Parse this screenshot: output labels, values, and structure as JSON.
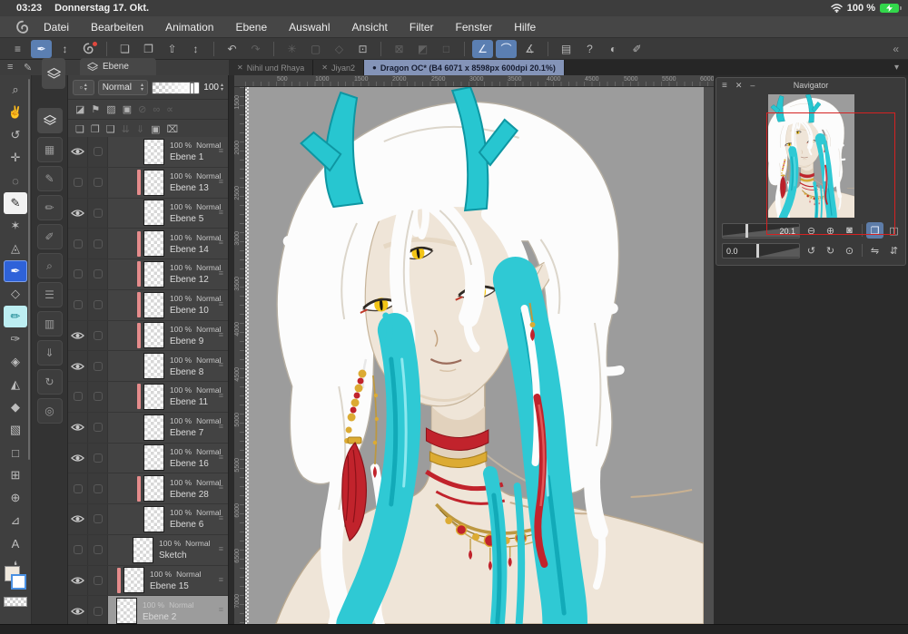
{
  "status_bar": {
    "time": "03:23",
    "date": "Donnerstag 17. Okt.",
    "battery_label": "100 %"
  },
  "menu_bar": {
    "items": [
      {
        "name": "menu-datei",
        "label": "Datei"
      },
      {
        "name": "menu-bearbeiten",
        "label": "Bearbeiten"
      },
      {
        "name": "menu-animation",
        "label": "Animation"
      },
      {
        "name": "menu-ebene",
        "label": "Ebene"
      },
      {
        "name": "menu-auswahl",
        "label": "Auswahl"
      },
      {
        "name": "menu-ansicht",
        "label": "Ansicht"
      },
      {
        "name": "menu-filter",
        "label": "Filter"
      },
      {
        "name": "menu-fenster",
        "label": "Fenster"
      },
      {
        "name": "menu-hilfe",
        "label": "Hilfe"
      }
    ]
  },
  "toolbar": {
    "buttons": [
      {
        "name": "main-menu-button",
        "glyph": "≡",
        "state": "normal"
      },
      {
        "name": "quick-access-button",
        "glyph": "✒",
        "state": "active"
      },
      {
        "name": "quick-access-expander",
        "glyph": "↕",
        "state": "normal"
      },
      {
        "name": "clip-studio-home-button",
        "kind": "logo",
        "state": "normal"
      },
      {
        "name": "divider",
        "kind": "divider",
        "interactable": false
      },
      {
        "name": "new-canvas-button",
        "glyph": "❏",
        "state": "normal"
      },
      {
        "name": "open-file-button",
        "glyph": "❐",
        "state": "normal"
      },
      {
        "name": "save-button",
        "glyph": "⇧",
        "state": "normal"
      },
      {
        "name": "save-expander",
        "glyph": "↕",
        "state": "normal"
      },
      {
        "name": "divider",
        "kind": "divider",
        "interactable": false
      },
      {
        "name": "undo-button",
        "glyph": "↶",
        "state": "normal"
      },
      {
        "name": "redo-button",
        "glyph": "↷",
        "state": "dim"
      },
      {
        "name": "divider",
        "kind": "divider",
        "interactable": false
      },
      {
        "name": "processing-indicator",
        "glyph": "✳",
        "state": "dim"
      },
      {
        "name": "select-area-button",
        "glyph": "▢",
        "state": "dim"
      },
      {
        "name": "deselect-button",
        "glyph": "◇",
        "state": "dim"
      },
      {
        "name": "transform-button",
        "glyph": "⊡",
        "state": "normal"
      },
      {
        "name": "divider",
        "kind": "divider",
        "interactable": false
      },
      {
        "name": "snap-off-button",
        "glyph": "⊠",
        "state": "dim"
      },
      {
        "name": "snap-gradient-button",
        "glyph": "◩",
        "state": "dim"
      },
      {
        "name": "snap-square-button",
        "glyph": "□",
        "state": "dim"
      },
      {
        "name": "divider",
        "kind": "divider",
        "interactable": false
      },
      {
        "name": "snap-to-ruler-button",
        "glyph": "∠",
        "state": "active"
      },
      {
        "name": "snap-to-special-ruler-button",
        "glyph": "⌒",
        "state": "active"
      },
      {
        "name": "snap-to-guide-button",
        "glyph": "∡",
        "state": "normal"
      },
      {
        "name": "divider",
        "kind": "divider",
        "interactable": false
      },
      {
        "name": "palette-layout-button",
        "glyph": "▤",
        "state": "normal"
      },
      {
        "name": "help-button",
        "glyph": "?",
        "state": "normal"
      },
      {
        "name": "display-settings-button",
        "glyph": "◐",
        "state": "normal"
      },
      {
        "name": "stylus-disconnect-button",
        "glyph": "✐",
        "state": "normal"
      }
    ],
    "collapse_glyph": "«"
  },
  "tab_bar": {
    "tabs": [
      {
        "name": "tab-nihil-und-rhayan",
        "prefix": "✕",
        "label": "Nihil und Rhaya",
        "state": "inactive"
      },
      {
        "name": "tab-jiyan2",
        "prefix": "✕",
        "label": "Jiyan2",
        "state": "inactive"
      },
      {
        "name": "tab-dragon-oc",
        "prefix": "●",
        "label": "Dragon OC* (B4 6071 x 8598px 600dpi 20.1%)",
        "state": "active"
      }
    ],
    "overflow_glyph": "▾"
  },
  "left_header": {
    "menu_glyph": "≡",
    "pen_glyph": "✎"
  },
  "tool_column": {
    "tools": [
      {
        "name": "zoom-tool",
        "glyph": "⌕",
        "state": "normal"
      },
      {
        "name": "hand-tool",
        "glyph": "✌",
        "state": "normal"
      },
      {
        "name": "rotate-canvas-tool",
        "glyph": "↺",
        "state": "normal"
      },
      {
        "name": "move-tool",
        "glyph": "✛",
        "state": "normal"
      },
      {
        "name": "lasso-tool",
        "glyph": "◌",
        "state": "normal"
      },
      {
        "name": "marker-tool",
        "glyph": "✎",
        "state": "white"
      },
      {
        "name": "magic-wand-tool",
        "glyph": "✶",
        "state": "normal"
      },
      {
        "name": "eyedropper-tool",
        "glyph": "◬",
        "state": "normal"
      },
      {
        "name": "pen-tool",
        "glyph": "✒",
        "state": "blue"
      },
      {
        "name": "eraser-tool",
        "glyph": "◇",
        "state": "normal"
      },
      {
        "name": "watercolor-brush-tool",
        "glyph": "✏",
        "state": "cyan"
      },
      {
        "name": "ink-pen-tool",
        "glyph": "✑",
        "state": "normal"
      },
      {
        "name": "eraser-soft-tool",
        "glyph": "◈",
        "state": "normal"
      },
      {
        "name": "blend-tool",
        "glyph": "◭",
        "state": "normal"
      },
      {
        "name": "fill-tool",
        "glyph": "◆",
        "state": "normal"
      },
      {
        "name": "gradient-tool",
        "glyph": "▧",
        "state": "normal"
      },
      {
        "name": "figure-tool",
        "glyph": "□",
        "state": "normal"
      },
      {
        "name": "frame-border-tool",
        "glyph": "⊞",
        "state": "normal"
      },
      {
        "name": "perspective-ruler-tool",
        "glyph": "⊕",
        "state": "normal"
      },
      {
        "name": "polyline-tool",
        "glyph": "⊿",
        "state": "normal"
      },
      {
        "name": "text-tool",
        "glyph": "A",
        "state": "normal"
      },
      {
        "name": "balloon-tool",
        "glyph": "❛",
        "state": "normal"
      }
    ]
  },
  "palette_dock": {
    "items": [
      {
        "name": "layer-palette-button",
        "kind": "stack",
        "state": "active"
      },
      {
        "name": "color-set-palette-button",
        "glyph": "▦",
        "state": "normal"
      },
      {
        "name": "sub-tool-palette-button",
        "glyph": "✎",
        "state": "normal"
      },
      {
        "name": "tool-property-palette-button",
        "glyph": "✏",
        "state": "normal"
      },
      {
        "name": "brush-size-palette-button",
        "glyph": "✐",
        "state": "normal"
      },
      {
        "name": "sub-view-palette-button",
        "glyph": "⌕",
        "state": "normal"
      },
      {
        "name": "layer-property-palette-button",
        "glyph": "☰",
        "state": "normal"
      },
      {
        "name": "material-palette-button",
        "glyph": "▥",
        "state": "normal"
      },
      {
        "name": "import-palette-button",
        "glyph": "⇓",
        "state": "normal"
      },
      {
        "name": "history-palette-button",
        "glyph": "↻",
        "state": "normal"
      },
      {
        "name": "edit-settings-palette-button",
        "glyph": "◎",
        "state": "normal"
      }
    ]
  },
  "layer_panel": {
    "tab_label": "Ebene",
    "combo_glyph": "▫",
    "step_up": "▴",
    "step_down": "▾",
    "blend_mode_value": "Normal",
    "opacity_value": "100",
    "lock_icons": [
      {
        "name": "clip-to-layer-below-button",
        "glyph": "◪",
        "state": "normal"
      },
      {
        "name": "reference-layer-button",
        "glyph": "⚑",
        "state": "normal"
      },
      {
        "name": "lock-transparent-pixels-button",
        "glyph": "▨",
        "state": "normal"
      },
      {
        "name": "lock-layer-button",
        "glyph": "▣",
        "state": "normal"
      },
      {
        "name": "enable-mask-button",
        "glyph": "⊘",
        "state": "dim"
      },
      {
        "name": "ruler-range-button",
        "glyph": "∞",
        "state": "dim"
      },
      {
        "name": "link-ruler-button",
        "glyph": "∝",
        "state": "dim"
      }
    ],
    "action_icons": [
      {
        "name": "new-raster-layer-button",
        "glyph": "❏",
        "state": "normal"
      },
      {
        "name": "new-vector-layer-button",
        "glyph": "❐",
        "state": "normal"
      },
      {
        "name": "new-layer-folder-button",
        "glyph": "❑",
        "state": "normal"
      },
      {
        "name": "merge-down-button",
        "glyph": "⇊",
        "state": "dim"
      },
      {
        "name": "transfer-down-button",
        "glyph": "⇓",
        "state": "dim"
      },
      {
        "name": "create-layer-mask-button",
        "glyph": "▣",
        "state": "normal"
      },
      {
        "name": "delete-layer-button",
        "glyph": "⌧",
        "state": "normal"
      }
    ],
    "layers": [
      {
        "name": "Ebene 1",
        "opacity": "100 %",
        "mode": "Normal",
        "visible": true,
        "marked": false,
        "indent": 3,
        "thumb": "teal-strokes"
      },
      {
        "name": "Ebene 13",
        "opacity": "100 %",
        "mode": "Normal",
        "visible": false,
        "marked": true,
        "indent": 3,
        "thumb": "purple-blob"
      },
      {
        "name": "Ebene 5",
        "opacity": "100 %",
        "mode": "Normal",
        "visible": true,
        "marked": false,
        "indent": 3,
        "thumb": "red-specks"
      },
      {
        "name": "Ebene 14",
        "opacity": "100 %",
        "mode": "Normal",
        "visible": false,
        "marked": true,
        "indent": 3,
        "thumb": "empty"
      },
      {
        "name": "Ebene 12",
        "opacity": "100 %",
        "mode": "Normal",
        "visible": false,
        "marked": true,
        "indent": 3,
        "thumb": "purple-dot"
      },
      {
        "name": "Ebene 10",
        "opacity": "100 %",
        "mode": "Normal",
        "visible": false,
        "marked": true,
        "indent": 3,
        "thumb": "red-dot"
      },
      {
        "name": "Ebene 9",
        "opacity": "100 %",
        "mode": "Normal",
        "visible": true,
        "marked": true,
        "indent": 3,
        "thumb": "cyan-dot"
      },
      {
        "name": "Ebene 8",
        "opacity": "100 %",
        "mode": "Normal",
        "visible": true,
        "marked": false,
        "indent": 3,
        "thumb": "empty"
      },
      {
        "name": "Ebene 11",
        "opacity": "100 %",
        "mode": "Normal",
        "visible": false,
        "marked": true,
        "indent": 3,
        "thumb": "dark-blob"
      },
      {
        "name": "Ebene 7",
        "opacity": "100 %",
        "mode": "Normal",
        "visible": true,
        "marked": false,
        "indent": 3,
        "thumb": "empty"
      },
      {
        "name": "Ebene 16",
        "opacity": "100 %",
        "mode": "Normal",
        "visible": true,
        "marked": false,
        "indent": 3,
        "thumb": "tiny-mark"
      },
      {
        "name": "Ebene 28",
        "opacity": "100 %",
        "mode": "Normal",
        "visible": false,
        "marked": true,
        "indent": 3,
        "thumb": "cream-fill"
      },
      {
        "name": "Ebene 6",
        "opacity": "100 %",
        "mode": "Normal",
        "visible": true,
        "marked": false,
        "indent": 3,
        "thumb": "cream-spots"
      },
      {
        "name": "Sketch",
        "opacity": "100 %",
        "mode": "Normal",
        "visible": false,
        "marked": false,
        "indent": 2,
        "thumb": "empty"
      },
      {
        "name": "Ebene 15",
        "opacity": "100 %",
        "mode": "Normal",
        "visible": true,
        "marked": true,
        "indent": 1,
        "thumb": "empty"
      },
      {
        "name": "Ebene 2",
        "opacity": "100 %",
        "mode": "Normal",
        "visible": true,
        "marked": false,
        "indent": 0,
        "thumb": "solid-gray"
      }
    ]
  },
  "canvas": {
    "ruler_top": [
      {
        "v": "500",
        "pos": 33
      },
      {
        "v": "1000",
        "pos": 75
      },
      {
        "v": "1500",
        "pos": 118
      },
      {
        "v": "2000",
        "pos": 160
      },
      {
        "v": "2500",
        "pos": 203
      },
      {
        "v": "3000",
        "pos": 245
      },
      {
        "v": "3500",
        "pos": 287
      },
      {
        "v": "4000",
        "pos": 330
      },
      {
        "v": "4500",
        "pos": 372
      },
      {
        "v": "5000",
        "pos": 415
      },
      {
        "v": "5500",
        "pos": 457
      },
      {
        "v": "6000",
        "pos": 499
      }
    ],
    "ruler_left": [
      {
        "v": "1500",
        "pos": 9
      },
      {
        "v": "2000",
        "pos": 59
      },
      {
        "v": "2500",
        "pos": 109
      },
      {
        "v": "3000",
        "pos": 159
      },
      {
        "v": "3500",
        "pos": 209
      },
      {
        "v": "4000",
        "pos": 259
      },
      {
        "v": "4500",
        "pos": 309
      },
      {
        "v": "5000",
        "pos": 359
      },
      {
        "v": "5500",
        "pos": 409
      },
      {
        "v": "6000",
        "pos": 459
      },
      {
        "v": "6500",
        "pos": 509
      },
      {
        "v": "7000",
        "pos": 559
      }
    ]
  },
  "navigator": {
    "title": "Navigator",
    "menu_glyph": "≡",
    "close_glyph": "✕",
    "minimize_glyph": "–",
    "zoom_value": "20.1",
    "rotation_value": "0.0",
    "row1_buttons": [
      {
        "name": "zoom-out-button",
        "glyph": "⊖",
        "state": "normal"
      },
      {
        "name": "zoom-in-button",
        "glyph": "⊕",
        "state": "normal"
      },
      {
        "name": "zoom-reset-button",
        "glyph": "◙",
        "state": "normal"
      },
      {
        "name": "divider",
        "kind": "divider",
        "interactable": false
      },
      {
        "name": "fit-to-screen-button",
        "glyph": "❐",
        "state": "active"
      },
      {
        "name": "fit-to-width-button",
        "glyph": "◫",
        "state": "normal"
      }
    ],
    "row2_buttons": [
      {
        "name": "rotate-ccw-button",
        "glyph": "↺",
        "state": "normal"
      },
      {
        "name": "rotate-cw-button",
        "glyph": "↻",
        "state": "normal"
      },
      {
        "name": "reset-rotation-button",
        "glyph": "⊙",
        "state": "normal"
      },
      {
        "name": "divider",
        "kind": "divider",
        "interactable": false
      },
      {
        "name": "flip-horizontal-button",
        "glyph": "⇋",
        "state": "normal"
      },
      {
        "name": "flip-vertical-button",
        "glyph": "⇵",
        "state": "normal"
      }
    ]
  },
  "artwork": {
    "palette": {
      "bg": "#9c9c9c",
      "skin": "#efe5d8",
      "hair": "#fcfcfc",
      "horn": "#27c6d0",
      "teal": "#2fc9d4",
      "eye": "#f3c517",
      "red": "#c1232c",
      "gold": "#dcab33",
      "view_rect": "#d42222"
    }
  }
}
